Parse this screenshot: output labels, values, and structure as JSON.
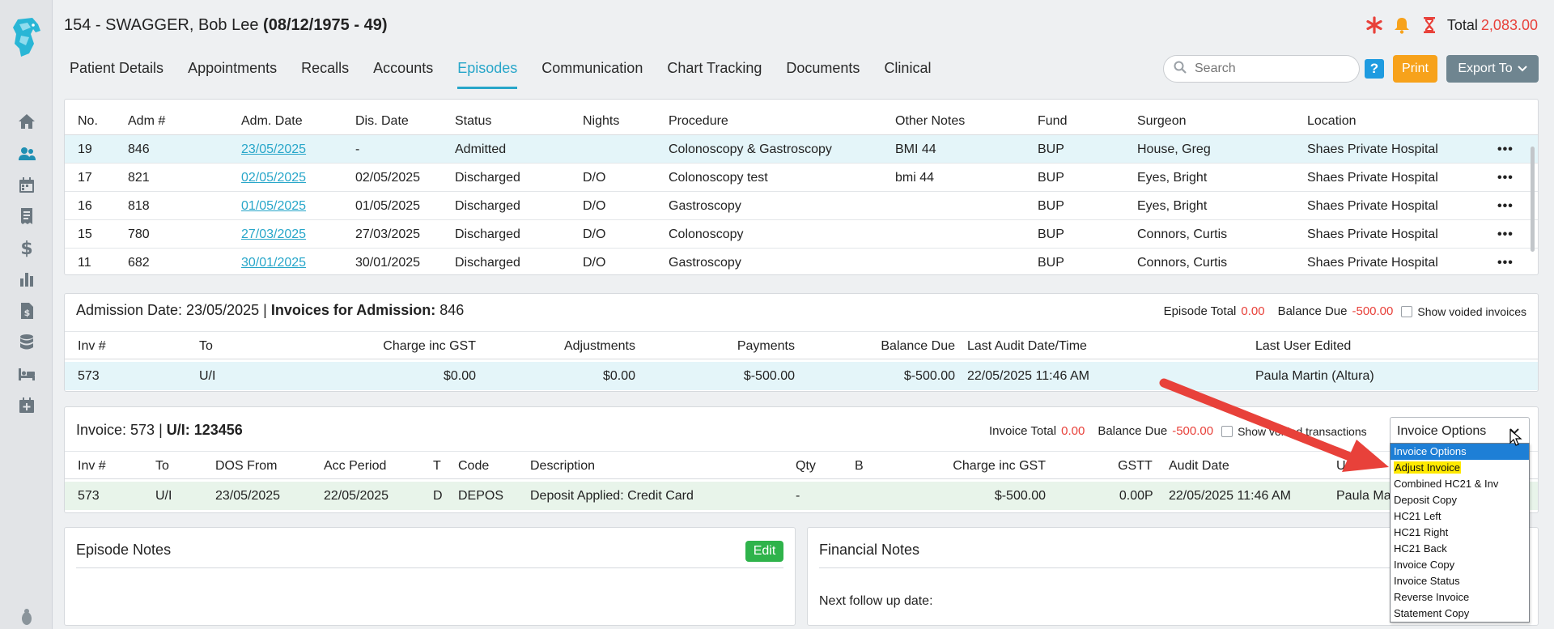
{
  "header": {
    "patient_name": "154 - SWAGGER, Bob Lee ",
    "patient_dob": "(08/12/1975 - 49)",
    "total_label": "Total",
    "total_value": "2,083.00"
  },
  "colors": {
    "accent": "#27a6c9",
    "alert": "#e8413a",
    "print": "#f7a21b",
    "export": "#6f8590",
    "edit": "#2fb34b"
  },
  "sidebar": {
    "icons": [
      "home-icon",
      "patients-icon",
      "calendar-icon",
      "receipt-icon",
      "dollar-icon",
      "chart-icon",
      "billing-icon",
      "database-icon",
      "bed-icon",
      "calendar-plus-icon",
      "bug-icon"
    ]
  },
  "tabs": [
    "Patient Details",
    "Appointments",
    "Recalls",
    "Accounts",
    "Episodes",
    "Communication",
    "Chart Tracking",
    "Documents",
    "Clinical"
  ],
  "toolbar": {
    "search_placeholder": "Search",
    "help_label": "?",
    "print_label": "Print",
    "export_label": "Export To"
  },
  "episodes": {
    "columns": [
      "No.",
      "Adm #",
      "Adm. Date",
      "Dis. Date",
      "Status",
      "Nights",
      "Procedure",
      "Other Notes",
      "Fund",
      "Surgeon",
      "Location"
    ],
    "rows": [
      {
        "no": "19",
        "adm": "846",
        "adm_date": "23/05/2025",
        "dis_date": "-",
        "status": "Admitted",
        "nights": "",
        "procedure": "Colonoscopy & Gastroscopy",
        "notes": "BMI 44",
        "fund": "BUP",
        "surgeon": "House, Greg",
        "location": "Shaes Private Hospital",
        "menu": "•••"
      },
      {
        "no": "17",
        "adm": "821",
        "adm_date": "02/05/2025",
        "dis_date": "02/05/2025",
        "status": "Discharged",
        "nights": "D/O",
        "procedure": "Colonoscopy test",
        "notes": "bmi 44",
        "fund": "BUP",
        "surgeon": "Eyes, Bright",
        "location": "Shaes Private Hospital",
        "menu": "•••"
      },
      {
        "no": "16",
        "adm": "818",
        "adm_date": "01/05/2025",
        "dis_date": "01/05/2025",
        "status": "Discharged",
        "nights": "D/O",
        "procedure": "Gastroscopy",
        "notes": "",
        "fund": "BUP",
        "surgeon": "Eyes, Bright",
        "location": "Shaes Private Hospital",
        "menu": "•••"
      },
      {
        "no": "15",
        "adm": "780",
        "adm_date": "27/03/2025",
        "dis_date": "27/03/2025",
        "status": "Discharged",
        "nights": "D/O",
        "procedure": "Colonoscopy",
        "notes": "",
        "fund": "BUP",
        "surgeon": "Connors, Curtis",
        "location": "Shaes Private Hospital",
        "menu": "•••"
      },
      {
        "no": "11",
        "adm": "682",
        "adm_date": "30/01/2025",
        "dis_date": "30/01/2025",
        "status": "Discharged",
        "nights": "D/O",
        "procedure": "Gastroscopy",
        "notes": "",
        "fund": "BUP",
        "surgeon": "Connors, Curtis",
        "location": "Shaes Private Hospital",
        "menu": "•••"
      }
    ]
  },
  "admission": {
    "title_prefix": "Admission Date: 23/05/2025 | ",
    "title_bold": "Invoices for Admission: ",
    "title_num": "846",
    "episode_total_label": "Episode Total",
    "episode_total_value": "0.00",
    "balance_label": "Balance Due",
    "balance_value": "-500.00",
    "show_voided_label": "Show voided invoices",
    "columns": [
      "Inv #",
      "To",
      "Charge inc GST",
      "Adjustments",
      "Payments",
      "Balance Due",
      "Last Audit Date/Time",
      "Last User Edited"
    ],
    "row": {
      "inv": "573",
      "to": "U/I",
      "charge": "$0.00",
      "adj": "$0.00",
      "payments": "$-500.00",
      "balance": "$-500.00",
      "audit": "22/05/2025 11:46 AM",
      "user": "Paula Martin (Altura)"
    }
  },
  "invoice": {
    "title_prefix": "Invoice: 573 | ",
    "title_bold": "U/I: 123456",
    "total_label": "Invoice Total",
    "total_value": "0.00",
    "balance_label": "Balance Due",
    "balance_value": "-500.00",
    "show_voided_label": "Show voided transactions",
    "options_label": "Invoice Options",
    "columns": [
      "Inv #",
      "To",
      "DOS From",
      "Acc Period",
      "T",
      "Code",
      "Description",
      "Qty",
      "B",
      "Charge inc GST",
      "GST",
      "T",
      "Audit Date",
      "User"
    ],
    "row": {
      "inv": "573",
      "to": "U/I",
      "dos": "23/05/2025",
      "acc": "22/05/2025",
      "t1": "D",
      "code": "DEPOS",
      "desc": "Deposit Applied: Credit Card",
      "qty": "-",
      "b": "",
      "charge": "$-500.00",
      "gst": "0.00",
      "t2": "P",
      "audit": "22/05/2025 11:46 AM",
      "user": "Paula Martin"
    }
  },
  "dropdown": {
    "items": [
      "Invoice Options",
      "Adjust Invoice",
      "Combined HC21 & Inv",
      "Deposit Copy",
      "HC21 Left",
      "HC21 Right",
      "HC21 Back",
      "Invoice Copy",
      "Invoice Status",
      "Reverse Invoice",
      "Statement Copy"
    ],
    "selected": "Invoice Options",
    "hovered": "Adjust Invoice"
  },
  "episode_notes": {
    "title": "Episode Notes",
    "edit_label": "Edit"
  },
  "financial_notes": {
    "title": "Financial Notes",
    "follow_up_label": "Next follow up date:"
  }
}
